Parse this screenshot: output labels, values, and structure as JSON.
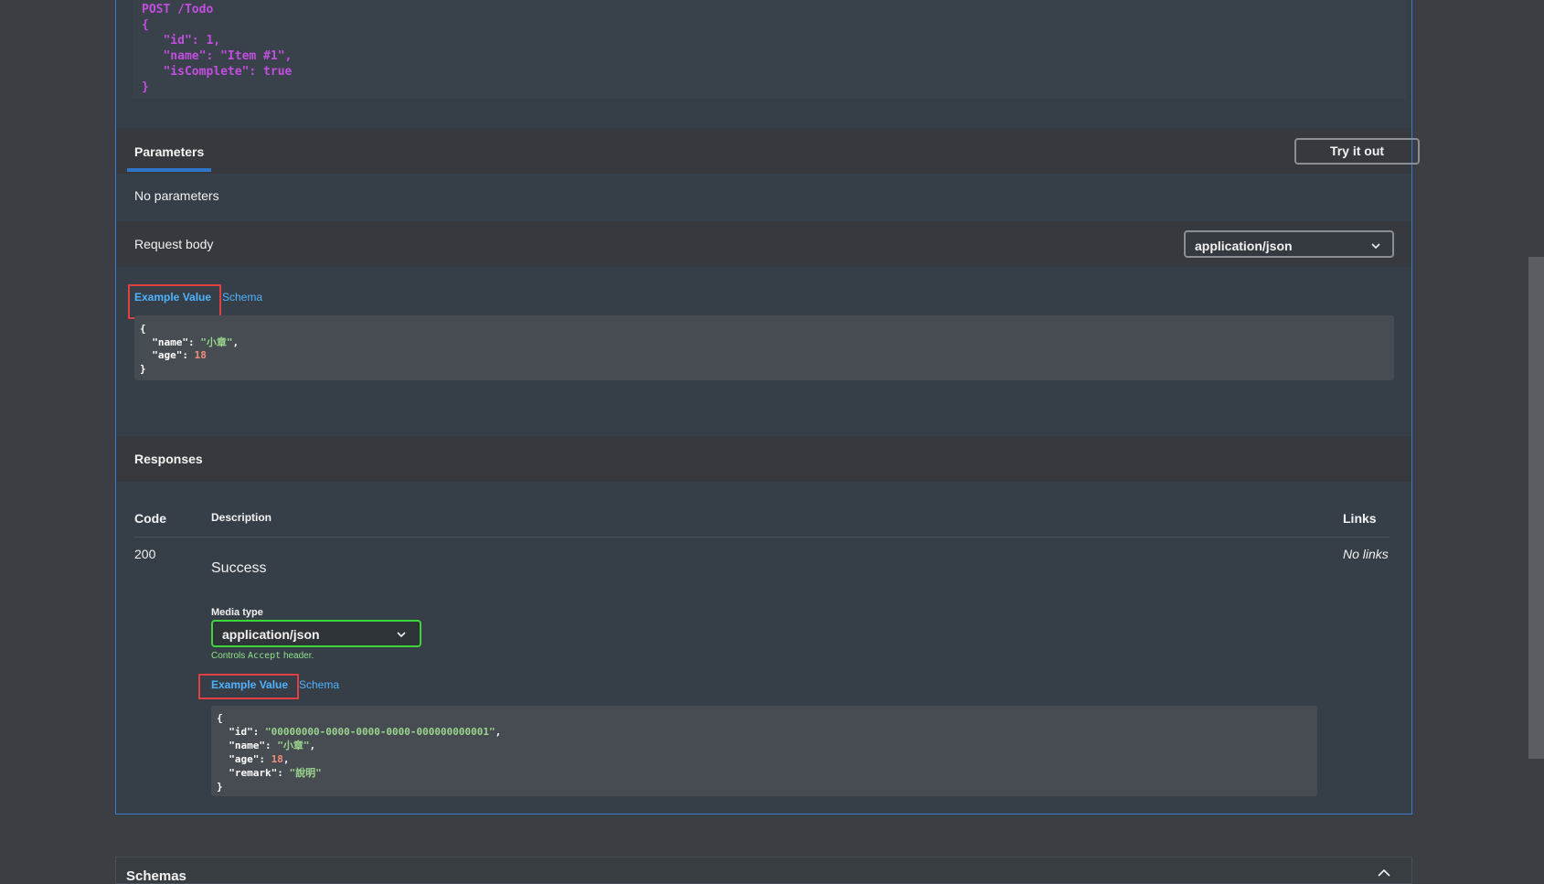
{
  "description_code": {
    "lines": [
      "POST /Todo",
      "{",
      "   \"id\": 1,",
      "   \"name\": \"Item #1\",",
      "   \"isComplete\": true",
      "}"
    ]
  },
  "parameters": {
    "tab_label": "Parameters",
    "try_button": "Try it out",
    "empty_text": "No parameters"
  },
  "request_body": {
    "label": "Request body",
    "content_type": "application/json",
    "tabs": {
      "example": "Example Value",
      "schema": "Schema"
    },
    "example_lines": [
      "{",
      "  \"name\": \"小章\",",
      "  \"age\": 18",
      "}"
    ]
  },
  "responses": {
    "title": "Responses",
    "headers": {
      "code": "Code",
      "description": "Description",
      "links": "Links"
    },
    "row": {
      "code": "200",
      "description": "Success",
      "links": "No links",
      "media_type_label": "Media type",
      "media_type_value": "application/json",
      "controls_prefix": "Controls",
      "controls_code": "Accept",
      "controls_suffix": "header.",
      "tabs": {
        "example": "Example Value",
        "schema": "Schema"
      },
      "example_lines": [
        "{",
        "  \"id\": \"00000000-0000-0000-0000-000000000001\",",
        "  \"name\": \"小章\",",
        "  \"age\": 18,",
        "  \"remark\": \"說明\"",
        "}"
      ]
    }
  },
  "schemas": {
    "title": "Schemas"
  },
  "colors": {
    "accent": "#3a7bd5",
    "highlight_box": "#e0403f",
    "media_select_border": "#3cd63c",
    "link": "#4fb3ff"
  }
}
